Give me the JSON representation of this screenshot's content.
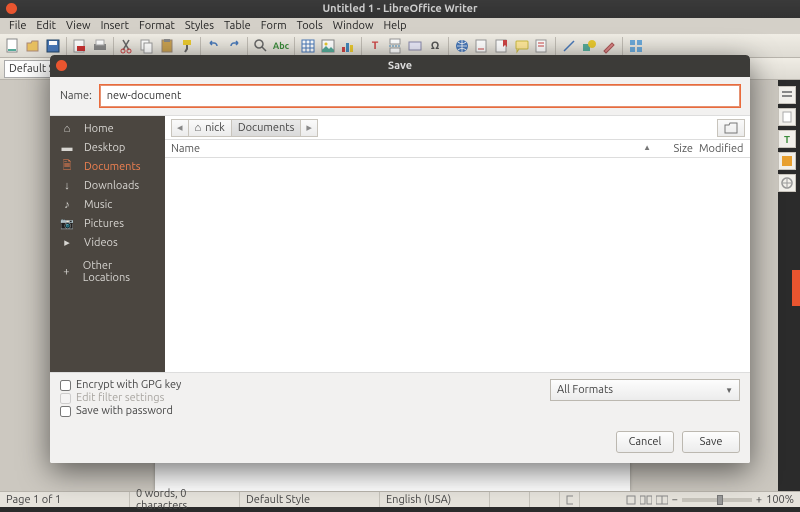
{
  "window": {
    "title": "Untitled 1 - LibreOffice Writer"
  },
  "menus": [
    "File",
    "Edit",
    "View",
    "Insert",
    "Format",
    "Styles",
    "Table",
    "Form",
    "Tools",
    "Window",
    "Help"
  ],
  "style_selector": "Default S",
  "statusbar": {
    "page": "Page 1 of 1",
    "words": "0 words, 0 characters",
    "style": "Default Style",
    "lang": "English (USA)",
    "zoom": "100%"
  },
  "dialog": {
    "title": "Save",
    "name_label": "Name:",
    "name_value": "new-document",
    "sidebar": [
      {
        "icon": "home",
        "label": "Home"
      },
      {
        "icon": "desktop",
        "label": "Desktop"
      },
      {
        "icon": "documents",
        "label": "Documents",
        "active": true
      },
      {
        "icon": "downloads",
        "label": "Downloads"
      },
      {
        "icon": "music",
        "label": "Music"
      },
      {
        "icon": "pictures",
        "label": "Pictures"
      },
      {
        "icon": "videos",
        "label": "Videos"
      }
    ],
    "other_locations": "Other Locations",
    "breadcrumb": {
      "home_user": "nick",
      "segments": [
        "Documents"
      ]
    },
    "columns": {
      "name": "Name",
      "size": "Size",
      "modified": "Modified"
    },
    "checks": {
      "gpg": "Encrypt with GPG key",
      "filter": "Edit filter settings",
      "pwd": "Save with password"
    },
    "format": "All Formats",
    "buttons": {
      "cancel": "Cancel",
      "save": "Save"
    }
  },
  "rsb_colors": [
    "#7a7a7a",
    "#ffffff",
    "#3a8a3a",
    "#e8a030",
    "#b0b0b0"
  ]
}
